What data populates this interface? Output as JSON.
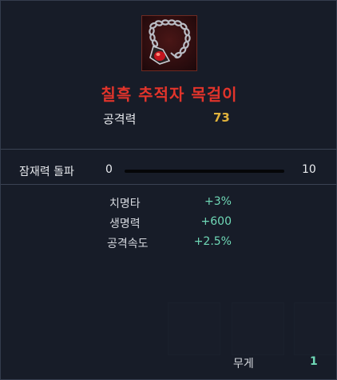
{
  "item": {
    "name": "칠흑 추적자 목걸이",
    "icon": "necklace-icon",
    "name_color": "#e2342b"
  },
  "main_stat": {
    "label": "공격력",
    "value": "73"
  },
  "potential": {
    "label": "잠재력 돌파",
    "min": "0",
    "max": "10",
    "progress": 0
  },
  "sub_stats": [
    {
      "label": "치명타",
      "value": "+3%"
    },
    {
      "label": "생명력",
      "value": "+600"
    },
    {
      "label": "공격속도",
      "value": "+2.5%"
    }
  ],
  "weight": {
    "label": "무게",
    "value": "1"
  },
  "colors": {
    "accent_value": "#e0b23c",
    "bonus_value": "#6fd8b6",
    "background": "#1d2330"
  }
}
